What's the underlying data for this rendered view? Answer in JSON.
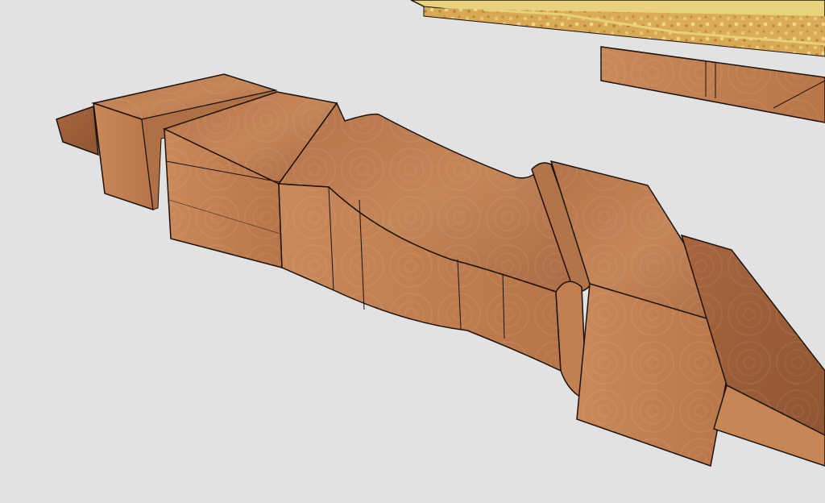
{
  "scene": {
    "colors": {
      "background": "#e2e2e2",
      "wood_light": "#c98a5e",
      "wood_mid": "#b9774a",
      "wood_dark": "#9a5d36",
      "edge": "#1b120c",
      "particleboard": "#d9aa55",
      "particleboard_edge": "#e7d07a"
    }
  }
}
